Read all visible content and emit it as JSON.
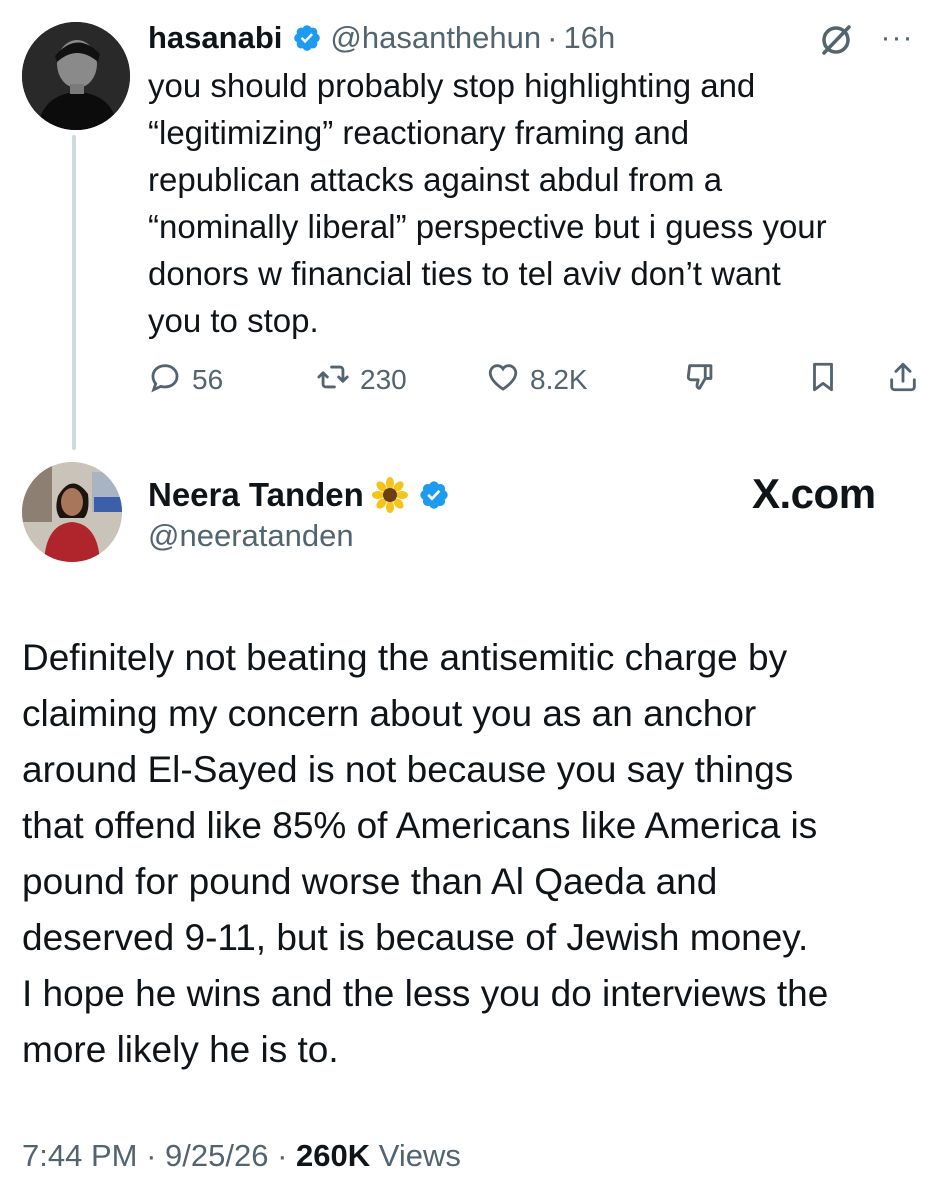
{
  "tweet1": {
    "display_name": "hasanabi",
    "handle": "@hasanthehun",
    "separator": "·",
    "time": "16h",
    "more": "···",
    "text_lines": [
      "you should probably stop highlighting and",
      "“legitimizing” reactionary framing and",
      "republican attacks against abdul from a",
      "“nominally liberal” perspective but i guess your",
      "donors w financial ties to tel aviv don’t want",
      "you to stop."
    ],
    "actions": {
      "replies": "56",
      "reposts": "230",
      "likes": "8.2K"
    }
  },
  "tweet2": {
    "display_name": "Neera Tanden",
    "handle": "@neeratanden",
    "watermark": "X.com",
    "text_lines": [
      "Definitely not beating the antisemitic charge by",
      "claiming my concern about you as an anchor",
      "around El-Sayed is not because you say things",
      "that offend like 85% of Americans like America is",
      "pound for pound worse than Al Qaeda and",
      "deserved 9-11, but is because of Jewish money.",
      "I hope he wins and the less you do interviews the",
      "more likely he is to."
    ],
    "meta": {
      "time": "7:44 PM",
      "sep1": "·",
      "date": "9/25/26",
      "sep2": "·",
      "views_count": "260K",
      "views_label": "Views"
    }
  },
  "colors": {
    "text": "#0f1419",
    "secondary": "#536471",
    "verified": "#1d9bf0",
    "thread_line": "#cfd9de"
  },
  "icons": [
    "verified-badge-icon",
    "grok-icon",
    "more-icon",
    "reply-icon",
    "repost-icon",
    "like-icon",
    "dislike-icon",
    "bookmark-icon",
    "share-icon",
    "sunflower-icon"
  ]
}
